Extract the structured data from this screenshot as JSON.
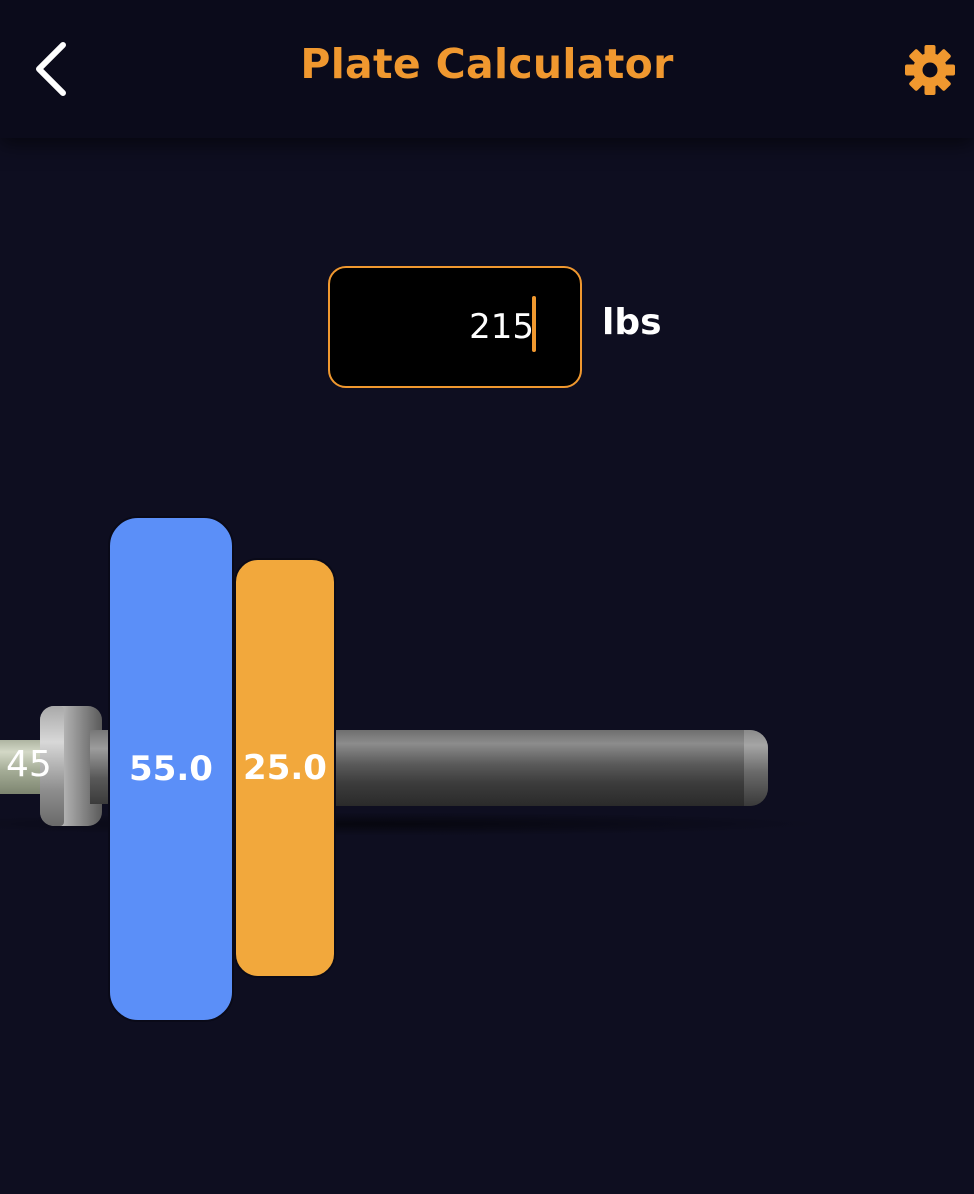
{
  "header": {
    "title": "Plate Calculator",
    "back_icon": "chevron-left-icon",
    "settings_icon": "gear-icon",
    "accent_color": "#f0982f"
  },
  "weight_input": {
    "value": "215",
    "unit": "lbs"
  },
  "barbell": {
    "bar_weight_label": "45",
    "plates": [
      {
        "label": "55.0",
        "color": "#5b8ff8"
      },
      {
        "label": "25.0",
        "color": "#f2a83c"
      }
    ]
  }
}
